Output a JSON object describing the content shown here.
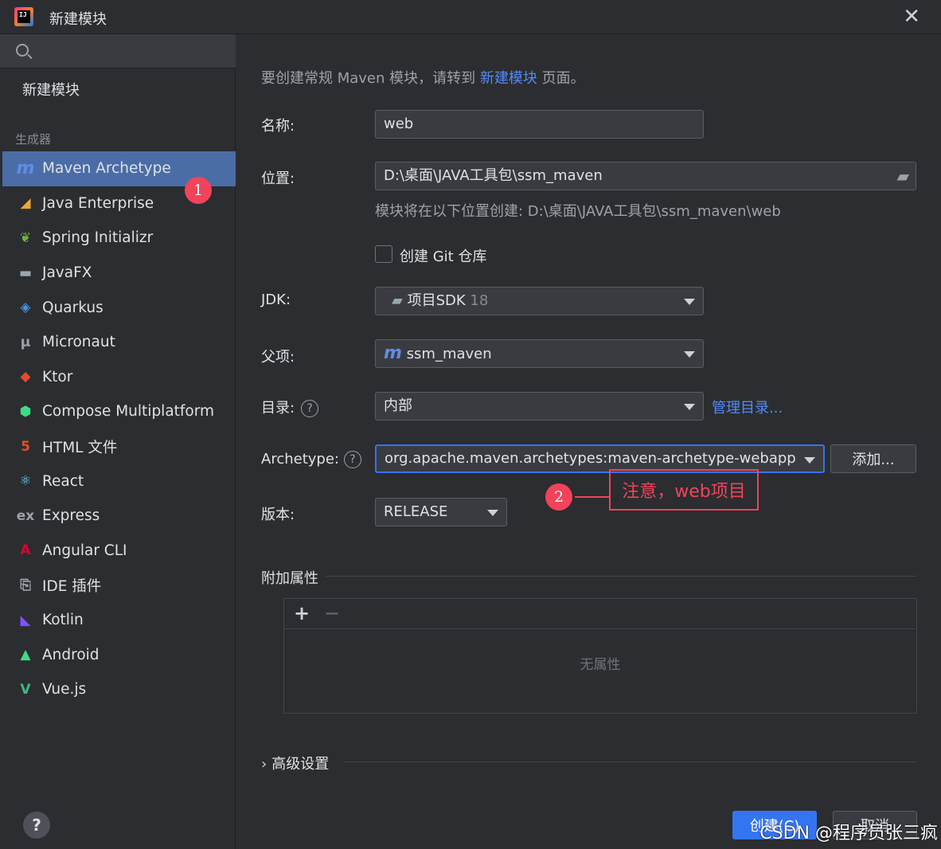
{
  "window": {
    "title": "新建模块"
  },
  "sidebar": {
    "new_module": "新建模块",
    "section_label": "生成器",
    "items": [
      {
        "label": "Maven Archetype",
        "icon": "maven-icon",
        "glyph": "m",
        "color": "#5d8ee6"
      },
      {
        "label": "Java Enterprise",
        "icon": "java-enterprise-icon",
        "glyph": "◢",
        "color": "#f0a732"
      },
      {
        "label": "Spring Initializr",
        "icon": "spring-icon",
        "glyph": "❦",
        "color": "#6db33f"
      },
      {
        "label": "JavaFX",
        "icon": "folder-icon",
        "glyph": "▬",
        "color": "#9aa7b0"
      },
      {
        "label": "Quarkus",
        "icon": "quarkus-icon",
        "glyph": "◈",
        "color": "#4695eb"
      },
      {
        "label": "Micronaut",
        "icon": "micronaut-icon",
        "glyph": "μ",
        "color": "#9ea1a8"
      },
      {
        "label": "Ktor",
        "icon": "ktor-icon",
        "glyph": "◆",
        "color": "#e34c26"
      },
      {
        "label": "Compose Multiplatform",
        "icon": "compose-icon",
        "glyph": "⬢",
        "color": "#3ddc84"
      },
      {
        "label": "HTML 文件",
        "icon": "html-icon",
        "glyph": "5",
        "color": "#e44d26"
      },
      {
        "label": "React",
        "icon": "react-icon",
        "glyph": "⚛",
        "color": "#61dafb"
      },
      {
        "label": "Express",
        "icon": "express-icon",
        "glyph": "ex",
        "color": "#9ea1a8"
      },
      {
        "label": "Angular CLI",
        "icon": "angular-icon",
        "glyph": "A",
        "color": "#dd0031"
      },
      {
        "label": "IDE 插件",
        "icon": "plugin-icon",
        "glyph": "⎘",
        "color": "#9ea1a8"
      },
      {
        "label": "Kotlin",
        "icon": "kotlin-icon",
        "glyph": "◣",
        "color": "#7f52ff"
      },
      {
        "label": "Android",
        "icon": "android-icon",
        "glyph": "▲",
        "color": "#3ddc84"
      },
      {
        "label": "Vue.js",
        "icon": "vue-icon",
        "glyph": "V",
        "color": "#42b883"
      }
    ],
    "badge1": "1",
    "help": "?"
  },
  "form": {
    "hint_prefix": "要创建常规 Maven 模块，请转到 ",
    "hint_link": "新建模块",
    "hint_suffix": " 页面。",
    "name_label": "名称:",
    "name_value": "web",
    "location_label": "位置:",
    "location_value": "D:\\桌面\\JAVA工具包\\ssm_maven",
    "location_sub": "模块将在以下位置创建: D:\\桌面\\JAVA工具包\\ssm_maven\\web",
    "git_label": "创建 Git 仓库",
    "jdk_label": "JDK:",
    "jdk_value": "项目SDK",
    "jdk_version": "18",
    "parent_label": "父项:",
    "parent_value": "ssm_maven",
    "catalog_label": "目录:",
    "catalog_value": "内部",
    "catalog_link": "管理目录...",
    "archetype_label": "Archetype:",
    "archetype_value": "org.apache.maven.archetypes:maven-archetype-webapp",
    "add_button": "添加...",
    "version_label": "版本:",
    "version_value": "RELEASE",
    "props_label": "附加属性",
    "props_empty": "无属性",
    "advanced_label": "高级设置"
  },
  "annotation": {
    "badge2": "2",
    "note": "注意，web项目"
  },
  "footer": {
    "create": "创建(C)",
    "cancel": "取消"
  },
  "watermark": "CSDN @程序员张三疯"
}
